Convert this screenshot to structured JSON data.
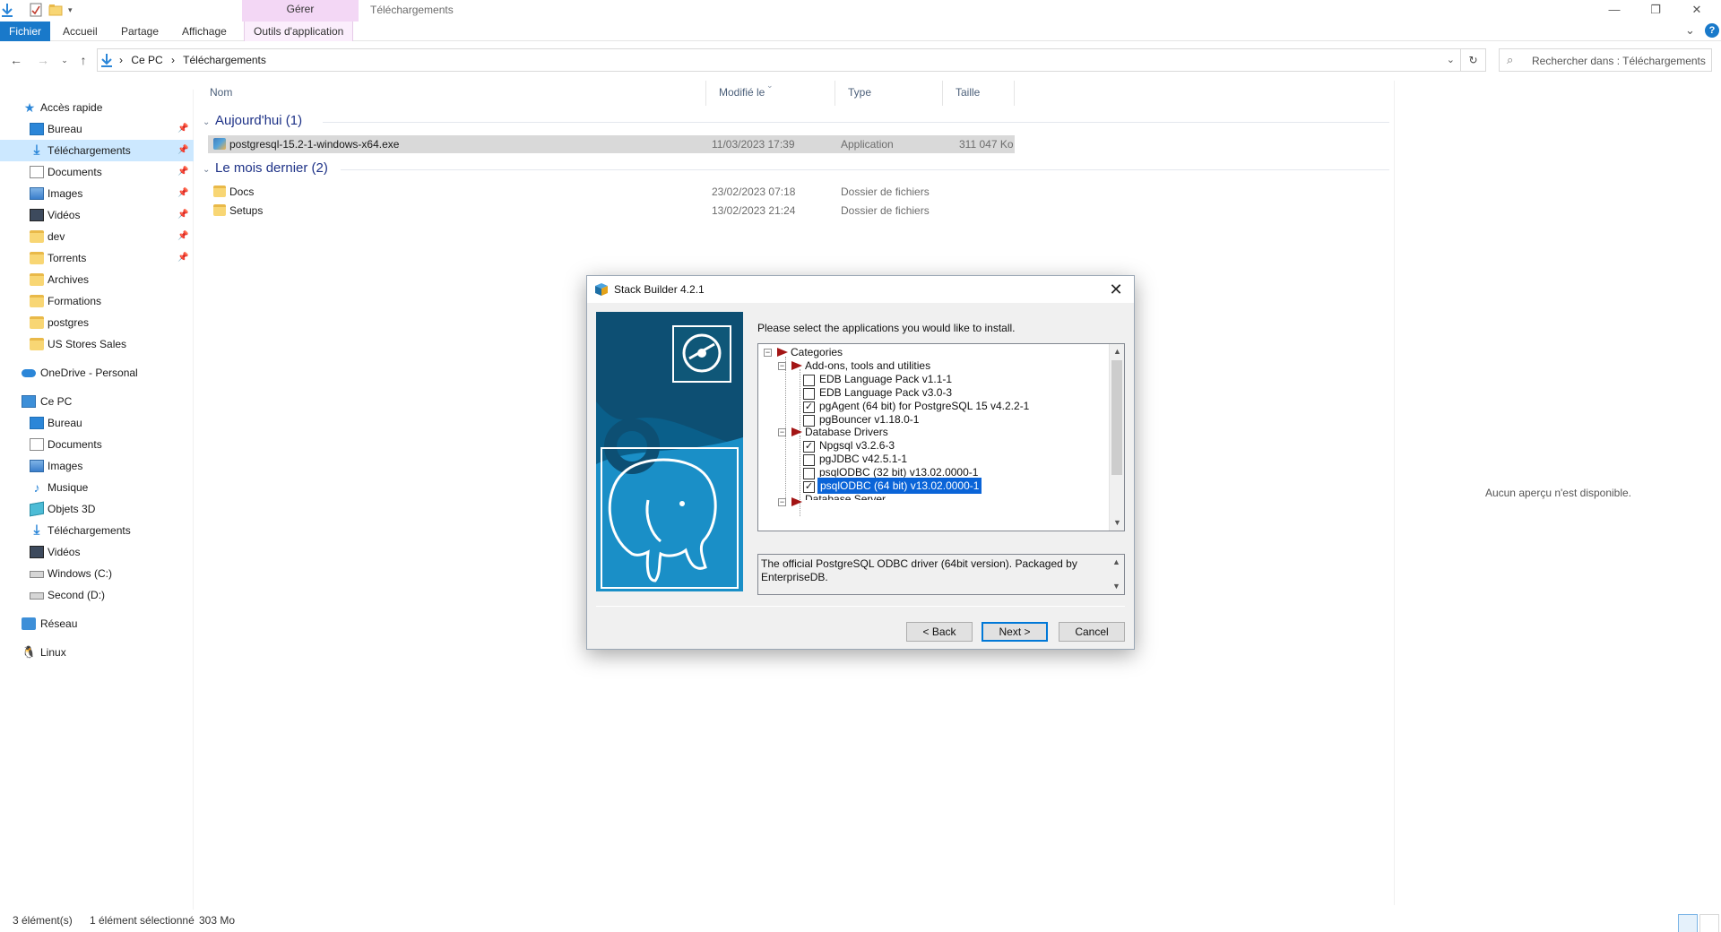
{
  "window": {
    "title": "Téléchargements",
    "context_tab_group": "Gérer",
    "controls": {
      "minimize": "—",
      "maximize": "❐",
      "close": "✕"
    }
  },
  "ribbon": {
    "tabs": [
      "Fichier",
      "Accueil",
      "Partage",
      "Affichage",
      "Outils d'application"
    ],
    "collapse": "⌄",
    "help": "?"
  },
  "address": {
    "crumbs": [
      "Ce PC",
      "Téléchargements"
    ],
    "separator": "›",
    "search_placeholder": "Rechercher dans : Téléchargements"
  },
  "sidebar": {
    "quick_access": {
      "label": "Accès rapide",
      "icon": "star-icon"
    },
    "quick_items": [
      {
        "label": "Bureau",
        "icon": "desktop-icon",
        "pinned": true
      },
      {
        "label": "Téléchargements",
        "icon": "download-icon",
        "pinned": true,
        "selected": true
      },
      {
        "label": "Documents",
        "icon": "documents-icon",
        "pinned": true
      },
      {
        "label": "Images",
        "icon": "images-icon",
        "pinned": true
      },
      {
        "label": "Vidéos",
        "icon": "videos-icon",
        "pinned": true
      },
      {
        "label": "dev",
        "icon": "folder-icon",
        "pinned": true
      },
      {
        "label": "Torrents",
        "icon": "folder-icon",
        "pinned": true
      },
      {
        "label": "Archives",
        "icon": "folder-icon",
        "pinned": false
      },
      {
        "label": "Formations",
        "icon": "folder-icon",
        "pinned": false
      },
      {
        "label": "postgres",
        "icon": "folder-icon",
        "pinned": false
      },
      {
        "label": "US Stores Sales",
        "icon": "folder-icon",
        "pinned": false
      }
    ],
    "onedrive": "OneDrive - Personal",
    "this_pc": "Ce PC",
    "pc_items": [
      {
        "label": "Bureau",
        "icon": "desktop-icon"
      },
      {
        "label": "Documents",
        "icon": "documents-icon"
      },
      {
        "label": "Images",
        "icon": "images-icon"
      },
      {
        "label": "Musique",
        "icon": "music-icon"
      },
      {
        "label": "Objets 3D",
        "icon": "objects3d-icon"
      },
      {
        "label": "Téléchargements",
        "icon": "download-icon"
      },
      {
        "label": "Vidéos",
        "icon": "videos-icon"
      },
      {
        "label": "Windows (C:)",
        "icon": "drive-icon"
      },
      {
        "label": "Second (D:)",
        "icon": "drive-icon"
      }
    ],
    "network": "Réseau",
    "linux": "Linux",
    "pin_glyph": "📌"
  },
  "filelist": {
    "columns": [
      "Nom",
      "Modifié le",
      "Type",
      "Taille"
    ],
    "groups": [
      {
        "title": "Aujourd'hui (1)",
        "files": [
          {
            "name": "postgresql-15.2-1-windows-x64.exe",
            "modified": "11/03/2023 17:39",
            "type": "Application",
            "size": "311 047 Ko",
            "icon": "exe-icon",
            "selected": true
          }
        ]
      },
      {
        "title": "Le mois dernier (2)",
        "files": [
          {
            "name": "Docs",
            "modified": "23/02/2023 07:18",
            "type": "Dossier de fichiers",
            "size": "",
            "icon": "folder-icon"
          },
          {
            "name": "Setups",
            "modified": "13/02/2023 21:24",
            "type": "Dossier de fichiers",
            "size": "",
            "icon": "folder-icon"
          }
        ]
      }
    ]
  },
  "preview": {
    "message": "Aucun aperçu n'est disponible."
  },
  "status": {
    "count": "3 élément(s)",
    "selection": "1 élément sélectionné",
    "size": "303 Mo"
  },
  "dialog": {
    "title": "Stack Builder 4.2.1",
    "close": "✕",
    "prompt": "Please select the applications you would like to install.",
    "tree": [
      {
        "label": "Categories",
        "level": 0,
        "kind": "category",
        "expanded": true
      },
      {
        "label": "Add-ons, tools and utilities",
        "level": 1,
        "kind": "category",
        "expanded": true
      },
      {
        "label": "EDB Language Pack v1.1-1",
        "level": 2,
        "kind": "item",
        "checked": false
      },
      {
        "label": "EDB Language Pack v3.0-3",
        "level": 2,
        "kind": "item",
        "checked": false
      },
      {
        "label": "pgAgent (64 bit) for PostgreSQL 15 v4.2.2-1",
        "level": 2,
        "kind": "item",
        "checked": true
      },
      {
        "label": "pgBouncer v1.18.0-1",
        "level": 2,
        "kind": "item",
        "checked": false
      },
      {
        "label": "Database Drivers",
        "level": 1,
        "kind": "category",
        "expanded": true
      },
      {
        "label": "Npgsql v3.2.6-3",
        "level": 2,
        "kind": "item",
        "checked": true
      },
      {
        "label": "pgJDBC v42.5.1-1",
        "level": 2,
        "kind": "item",
        "checked": false
      },
      {
        "label": "psqlODBC (32 bit) v13.02.0000-1",
        "level": 2,
        "kind": "item",
        "checked": false
      },
      {
        "label": "psqlODBC (64 bit) v13.02.0000-1",
        "level": 2,
        "kind": "item",
        "checked": true,
        "highlighted": true
      },
      {
        "label": "Database Server",
        "level": 1,
        "kind": "category",
        "expanded": true
      }
    ],
    "description": "The official PostgreSQL ODBC driver (64bit version). Packaged by EnterpriseDB.",
    "buttons": {
      "back": "< Back",
      "next": "Next >",
      "cancel": "Cancel"
    },
    "check_glyph": "✓",
    "collapse_glyph": "−"
  },
  "colors": {
    "accent": "#1979ca",
    "selection": "#cce8ff",
    "context_tab": "#f3d7f5",
    "group_heading": "#1e3287",
    "tree_highlight": "#0a64d8",
    "banner": "#0e6d9c",
    "flag": "#a31515"
  }
}
